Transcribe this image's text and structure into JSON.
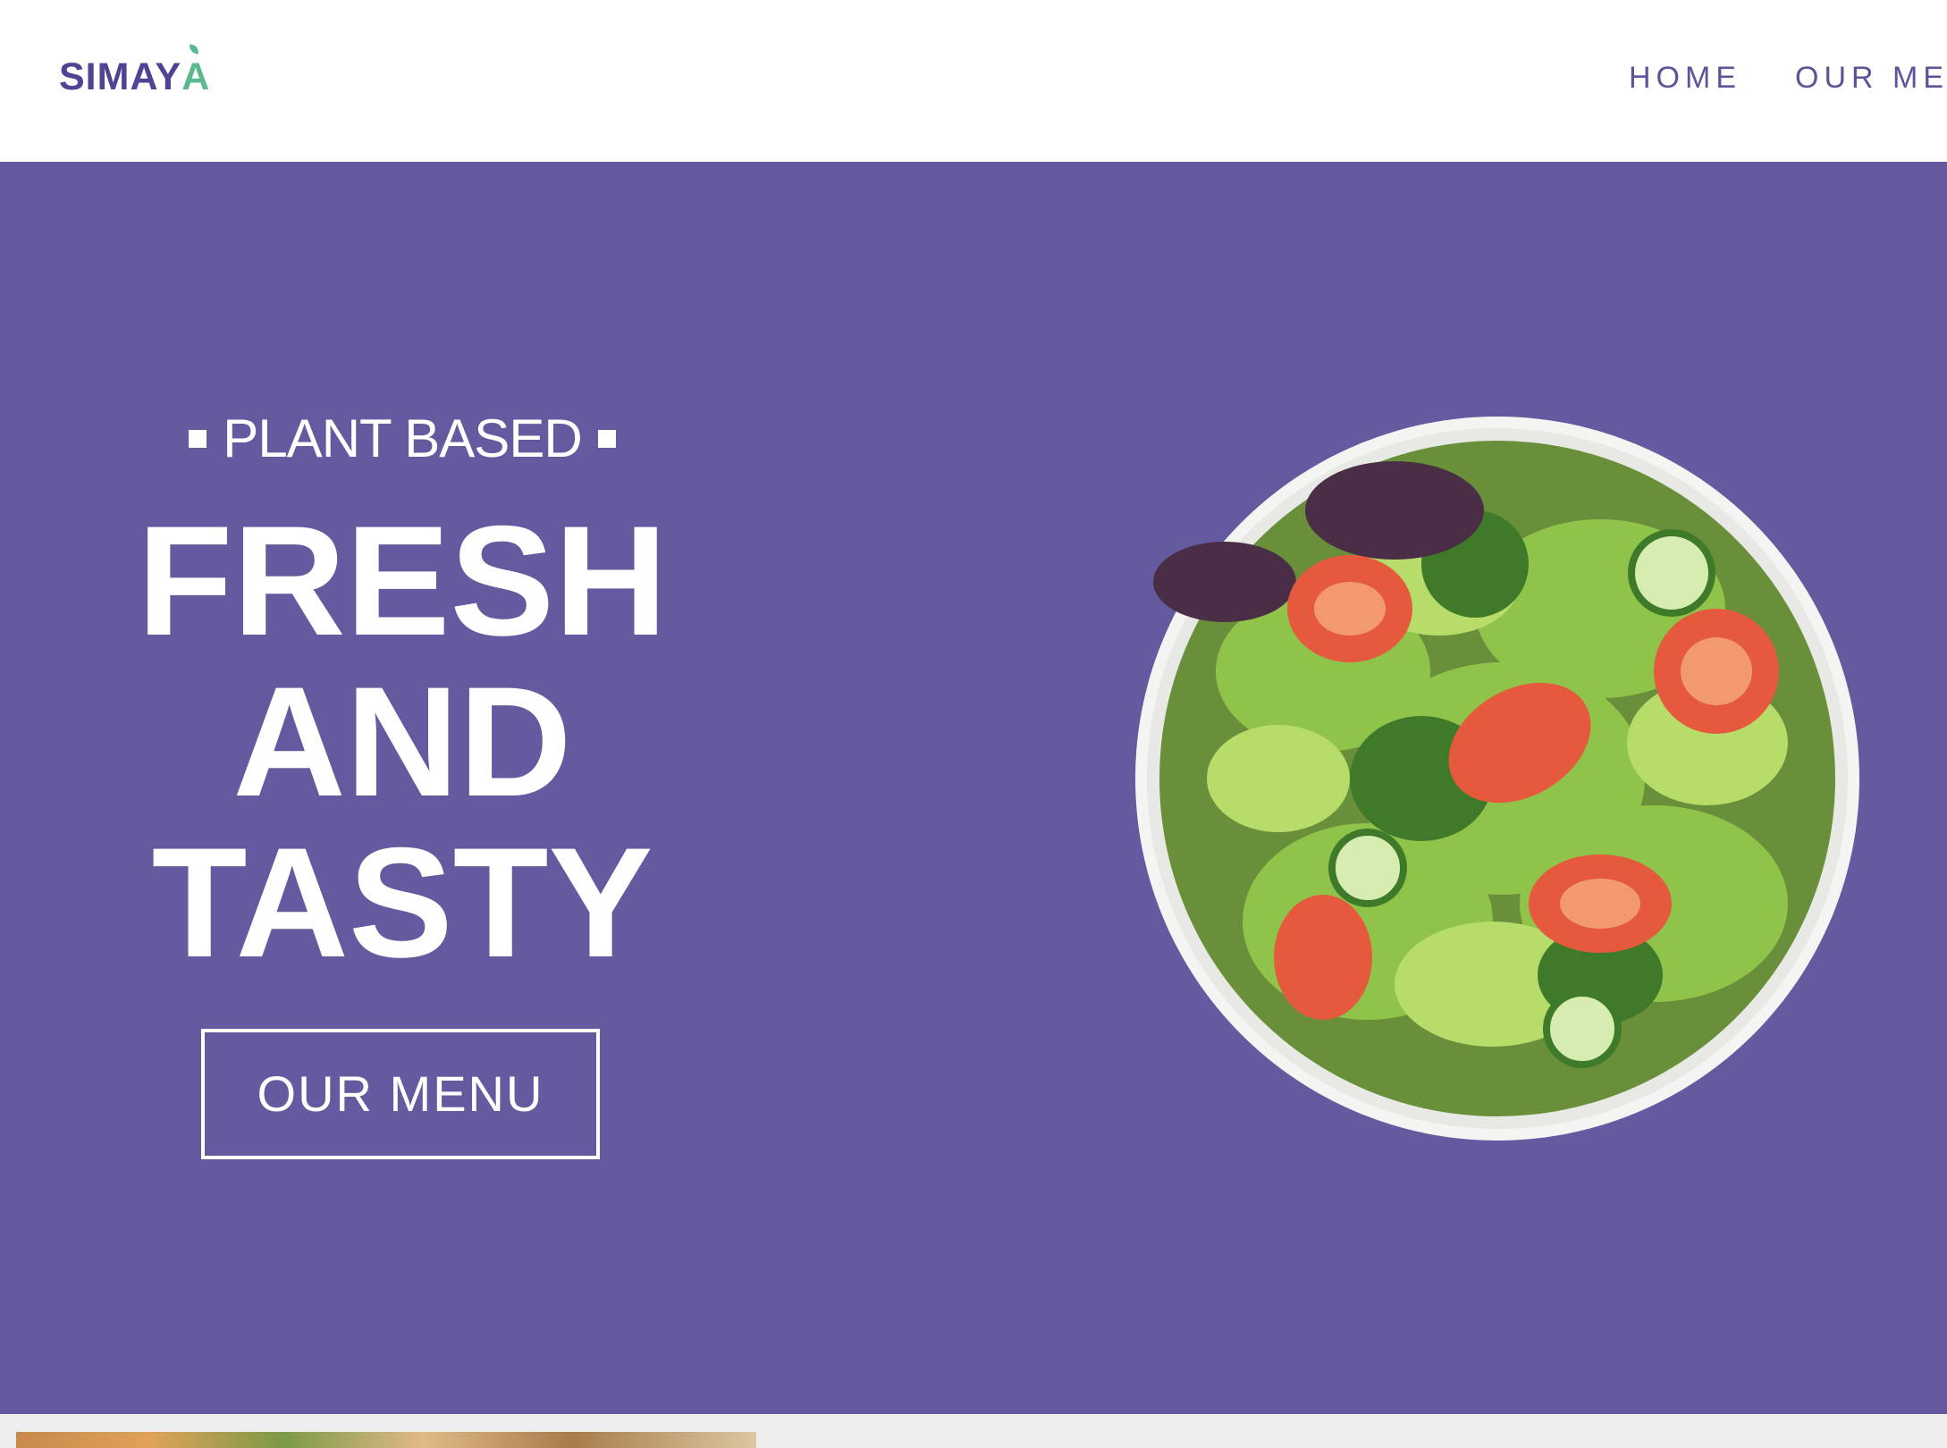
{
  "brand": {
    "name_main": "SIMAY",
    "name_accent": "A",
    "primary_color": "#4f4494",
    "accent_color": "#5cb88e"
  },
  "nav": {
    "items": [
      {
        "label": "HOME"
      },
      {
        "label": "OUR MEN"
      }
    ]
  },
  "hero": {
    "background_color": "#655a9f",
    "eyebrow": "PLANT BASED",
    "headline": [
      "FRESH",
      "AND",
      "TASTY"
    ],
    "cta_label": "OUR MENU",
    "image": "salad-bowl-image"
  }
}
